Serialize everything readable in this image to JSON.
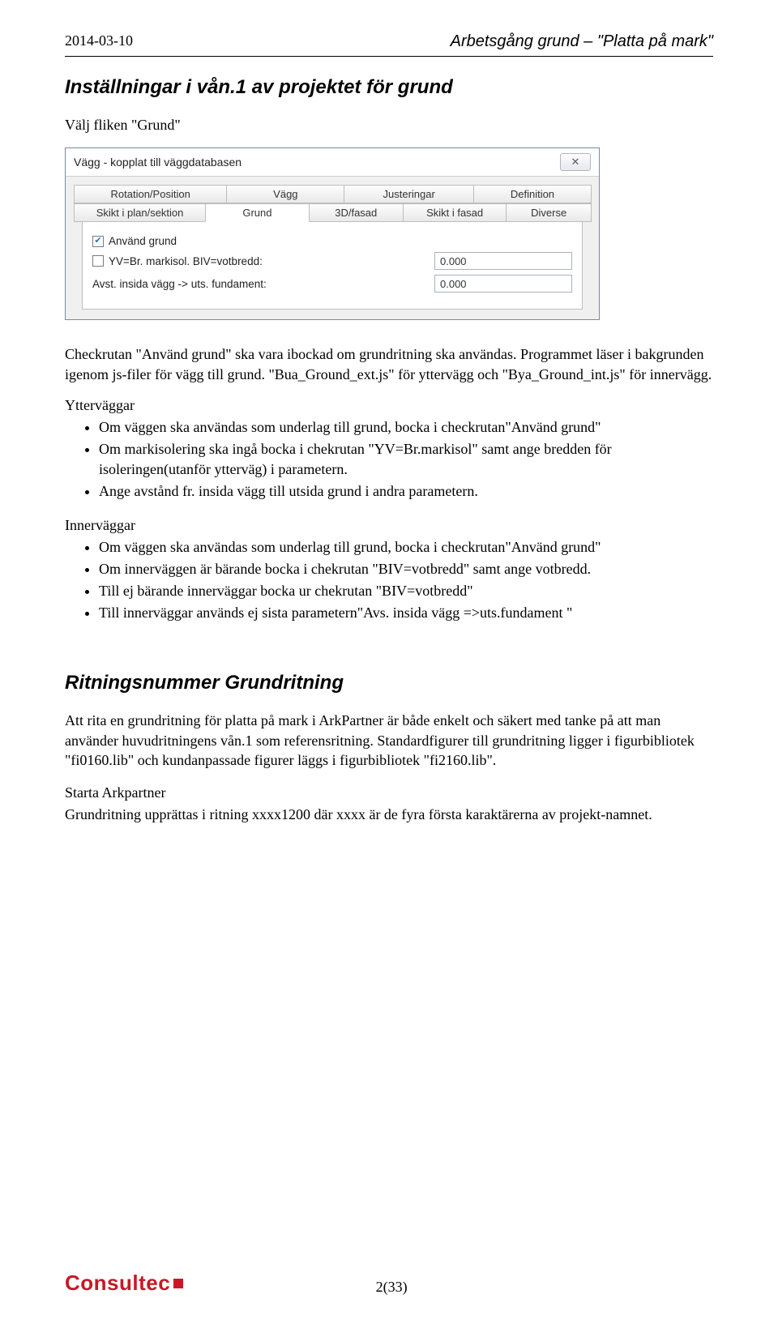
{
  "header": {
    "date": "2014-03-10",
    "doc_title": "Arbetsgång grund – \"Platta på mark\""
  },
  "section1": {
    "title": "Inställningar i vån.1 av projektet för grund",
    "intro": "Välj fliken \"Grund\""
  },
  "dialog": {
    "title": "Vägg - kopplat till väggdatabasen",
    "close_glyph": "✕",
    "tabs_row1": [
      "Rotation/Position",
      "Vägg",
      "Justeringar",
      "Definition"
    ],
    "tabs_row2": [
      "Skikt i plan/sektion",
      "Grund",
      "3D/fasad",
      "Skikt i fasad",
      "Diverse"
    ],
    "selected_tab": "Grund",
    "chk_use_ground": {
      "label": "Använd grund",
      "checked": true
    },
    "chk_yv": {
      "label": "YV=Br. markisol. BIV=votbredd:",
      "checked": false,
      "value": "0.000"
    },
    "avst_label": "Avst. insida vägg -> uts. fundament:",
    "avst_value": "0.000"
  },
  "para_after_dialog": [
    "Checkrutan \"Använd grund\" ska vara ibockad om grundritning ska användas. Programmet läser i bakgrunden igenom js-filer för vägg till grund. \"Bua_Ground_ext.js\" för yttervägg och \"Bya_Ground_int.js\" för innervägg."
  ],
  "outer_walls": {
    "heading": "Ytterväggar",
    "items": [
      "Om väggen ska användas som underlag till grund, bocka i checkrutan\"Använd grund\"",
      "Om markisolering ska ingå bocka i chekrutan \"YV=Br.markisol\" samt ange bredden för isoleringen(utanför ytterväg) i parametern.",
      "Ange avstånd fr. insida vägg till utsida grund i andra parametern."
    ]
  },
  "inner_walls": {
    "heading": "Innerväggar",
    "items": [
      "Om väggen ska användas som underlag till grund, bocka i checkrutan\"Använd grund\"",
      "Om innerväggen är bärande bocka i chekrutan \"BIV=votbredd\" samt ange votbredd.",
      "Till ej bärande innerväggar bocka ur chekrutan \"BIV=votbredd\"",
      "Till innerväggar används ej sista parametern\"Avs. insida vägg =>uts.fundament \""
    ]
  },
  "section2": {
    "title": "Ritningsnummer Grundritning",
    "p1": "Att rita en grundritning för platta på mark i ArkPartner är både enkelt och säkert med tanke på att man använder huvudritningens vån.1 som referensritning. Standardfigurer till grundritning ligger i figurbibliotek \"fi0160.lib\" och kundanpassade figurer läggs i figurbibliotek  \"fi2160.lib\".",
    "p2_lead": "Starta Arkpartner",
    "p2_body": "Grundritning upprättas i ritning xxxx1200 där xxxx är de fyra första karaktärerna av projekt-namnet."
  },
  "footer": {
    "logo_text": "Consultec",
    "page_num": "2(33)"
  }
}
